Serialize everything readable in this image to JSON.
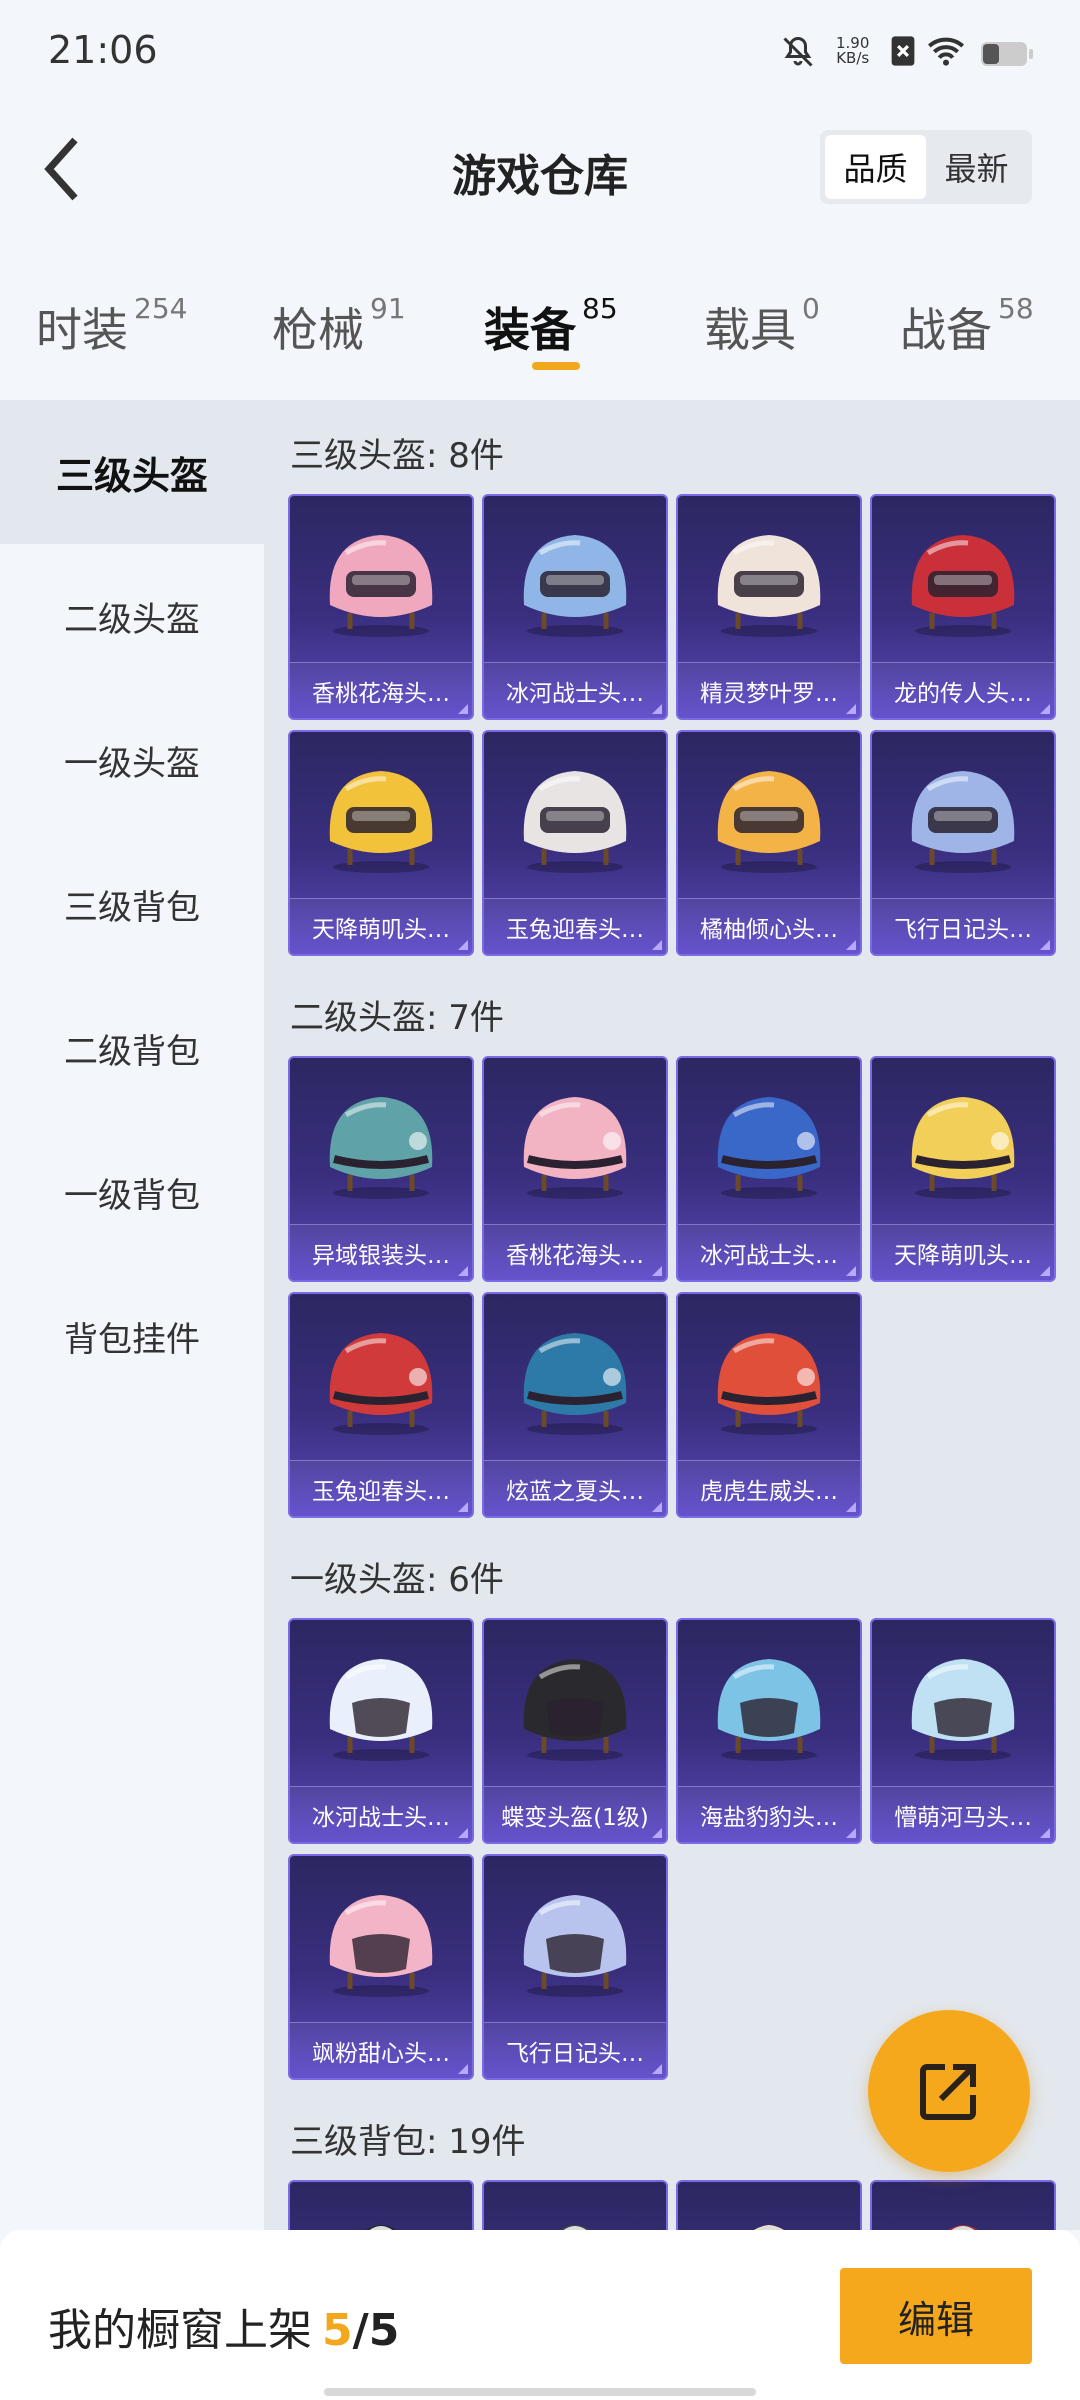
{
  "status": {
    "time": "21:06",
    "net_speed_value": "1.90",
    "net_speed_unit": "KB/s"
  },
  "header": {
    "title": "游戏仓库",
    "sort_options": [
      "品质",
      "最新"
    ],
    "sort_active": 0
  },
  "tabs": [
    {
      "label": "时装",
      "count": "254"
    },
    {
      "label": "枪械",
      "count": "91"
    },
    {
      "label": "装备",
      "count": "85"
    },
    {
      "label": "载具",
      "count": "0"
    },
    {
      "label": "战备",
      "count": "58"
    }
  ],
  "active_tab": 2,
  "sidebar": [
    "三级头盔",
    "二级头盔",
    "一级头盔",
    "三级背包",
    "二级背包",
    "一级背包",
    "背包挂件"
  ],
  "active_sidebar": 0,
  "sections": [
    {
      "title": "三级头盔: 8件",
      "items": [
        {
          "name": "香桃花海头…",
          "icon": "helmet-l3",
          "color": "#f0a8bf"
        },
        {
          "name": "冰河战士头…",
          "icon": "helmet-l3",
          "color": "#8fb6e6"
        },
        {
          "name": "精灵梦叶罗…",
          "icon": "helmet-l3",
          "color": "#efe3da"
        },
        {
          "name": "龙的传人头…",
          "icon": "helmet-l3",
          "color": "#c9303a"
        },
        {
          "name": "天降萌叽头…",
          "icon": "helmet-l3",
          "color": "#f2c23a"
        },
        {
          "name": "玉兔迎春头…",
          "icon": "helmet-l3",
          "color": "#e8e4e4"
        },
        {
          "name": "橘柚倾心头…",
          "icon": "helmet-l3",
          "color": "#f4b347"
        },
        {
          "name": "飞行日记头…",
          "icon": "helmet-l3",
          "color": "#9fb5e8"
        }
      ]
    },
    {
      "title": "二级头盔: 7件",
      "items": [
        {
          "name": "异域银装头…",
          "icon": "helmet-l2",
          "color": "#5fa3a8"
        },
        {
          "name": "香桃花海头…",
          "icon": "helmet-l2",
          "color": "#f2b3c3"
        },
        {
          "name": "冰河战士头…",
          "icon": "helmet-l2",
          "color": "#3a68c8"
        },
        {
          "name": "天降萌叽头…",
          "icon": "helmet-l2",
          "color": "#f2cf58"
        },
        {
          "name": "玉兔迎春头…",
          "icon": "helmet-l2",
          "color": "#d13a3a"
        },
        {
          "name": "炫蓝之夏头…",
          "icon": "helmet-l2",
          "color": "#2d7aa8"
        },
        {
          "name": "虎虎生威头…",
          "icon": "helmet-l2",
          "color": "#e04f3a"
        }
      ]
    },
    {
      "title": "一级头盔: 6件",
      "items": [
        {
          "name": "冰河战士头…",
          "icon": "helmet-l1",
          "color": "#eaf0fb"
        },
        {
          "name": "蝶变头盔(1级)",
          "icon": "helmet-l1",
          "color": "#2a2a2e"
        },
        {
          "name": "海盐豹豹头…",
          "icon": "helmet-l1",
          "color": "#7cc3e6"
        },
        {
          "name": "懵萌河马头…",
          "icon": "helmet-l1",
          "color": "#bfe1f3"
        },
        {
          "name": "飒粉甜心头…",
          "icon": "helmet-l1",
          "color": "#f4b4c8"
        },
        {
          "name": "飞行日记头…",
          "icon": "helmet-l1",
          "color": "#b9c4ee"
        }
      ]
    },
    {
      "title": "三级背包: 19件",
      "items": [
        {
          "name": "",
          "icon": "backpack",
          "color": "#222"
        },
        {
          "name": "",
          "icon": "backpack",
          "color": "#444"
        },
        {
          "name": "",
          "icon": "backpack",
          "color": "#f0e2c0"
        },
        {
          "name": "",
          "icon": "backpack",
          "color": "#a03030"
        }
      ]
    }
  ],
  "bottom": {
    "showcase_label": "我的橱窗上架",
    "showcase_current": "5",
    "showcase_sep": "/",
    "showcase_max": "5",
    "edit_label": "编辑"
  },
  "colors": {
    "accent": "#f2a81d",
    "card_top": "#2c2762",
    "card_bottom": "#5a49b8"
  }
}
